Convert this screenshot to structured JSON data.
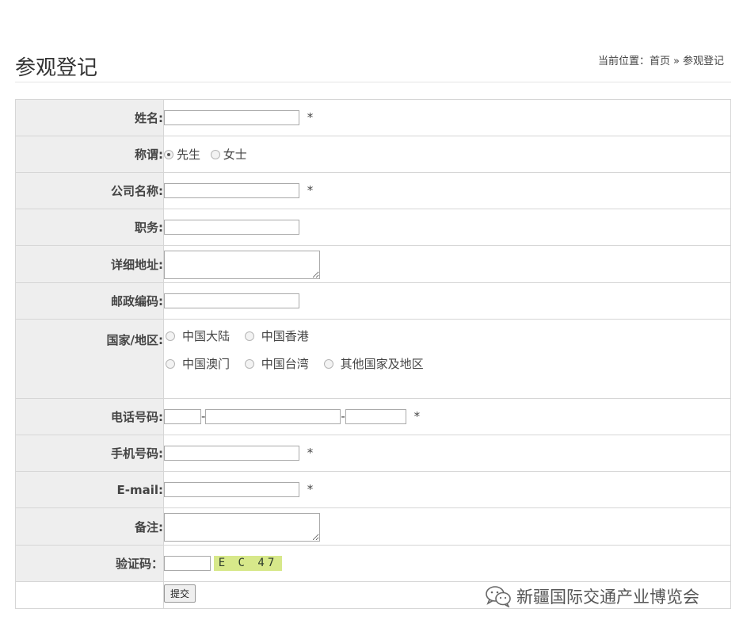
{
  "header": {
    "title": "参观登记",
    "breadcrumb": {
      "prefix": "当前位置：",
      "home": "首页",
      "separator": "»",
      "current": "参观登记"
    }
  },
  "form": {
    "name": {
      "label": "姓名:",
      "value": "",
      "required": "*"
    },
    "salutation": {
      "label": "称谓:",
      "options": [
        "先生",
        "女士"
      ],
      "selected": "先生"
    },
    "company": {
      "label": "公司名称:",
      "value": "",
      "required": "*"
    },
    "position": {
      "label": "职务:",
      "value": ""
    },
    "address": {
      "label": "详细地址:",
      "value": ""
    },
    "postcode": {
      "label": "邮政编码:",
      "value": ""
    },
    "region": {
      "label": "国家/地区:",
      "options": [
        "中国大陆",
        "中国香港",
        "中国澳门",
        "中国台湾",
        "其他国家及地区"
      ],
      "selected": ""
    },
    "phone": {
      "label": "电话号码:",
      "separator": "-",
      "required": "*"
    },
    "mobile": {
      "label": "手机号码:",
      "value": "",
      "required": "*"
    },
    "email": {
      "label": "E-mail:",
      "value": "",
      "required": "*"
    },
    "remarks": {
      "label": "备注:",
      "value": ""
    },
    "captcha": {
      "label": "验证码：",
      "value": "",
      "image_text": "E C 47"
    },
    "submit_label": "提交"
  },
  "watermark": {
    "text": "新疆国际交通产业博览会",
    "icon": "wechat-icon"
  }
}
